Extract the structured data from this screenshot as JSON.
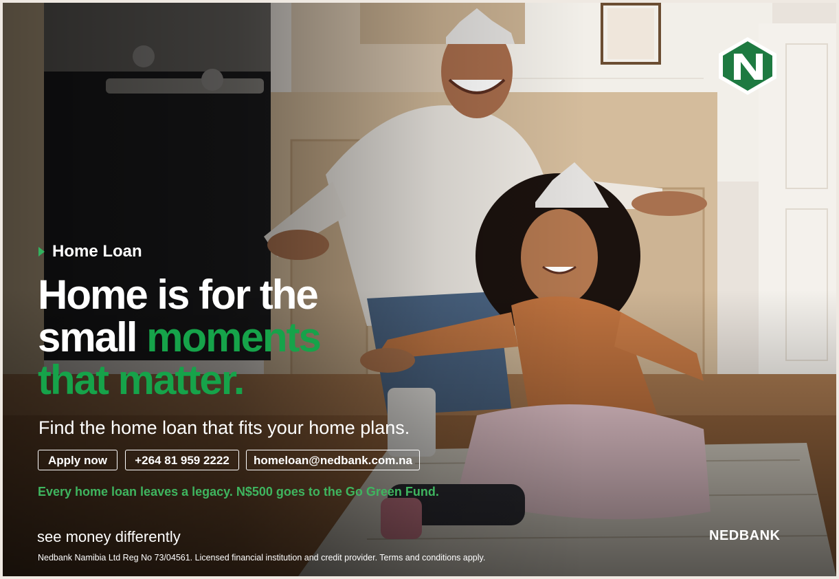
{
  "ad": {
    "eyebrow": "Home Loan",
    "headline": {
      "line1": "Home is for the",
      "line2_white": "small ",
      "line2_green": "moments",
      "line3": "that matter."
    },
    "subheadline": "Find the home loan that fits your home plans.",
    "buttons": {
      "apply": "Apply now",
      "phone": "+264 81 959 2222",
      "email": "homeloan@nedbank.com.na"
    },
    "legacy": "Every home loan leaves a legacy. N$500 goes to the Go Green Fund.",
    "tagline": "see money differently",
    "brand": "NEDBANK",
    "legal": "Nedbank Namibia Ltd Reg No 73/04561. Licensed financial institution and credit provider. Terms and conditions apply.",
    "logo_icon": "nedbank-n-logo",
    "colors": {
      "accent_green": "#16a34a",
      "legacy_green": "#3fb55f",
      "logo_green": "#1e7a41"
    }
  }
}
